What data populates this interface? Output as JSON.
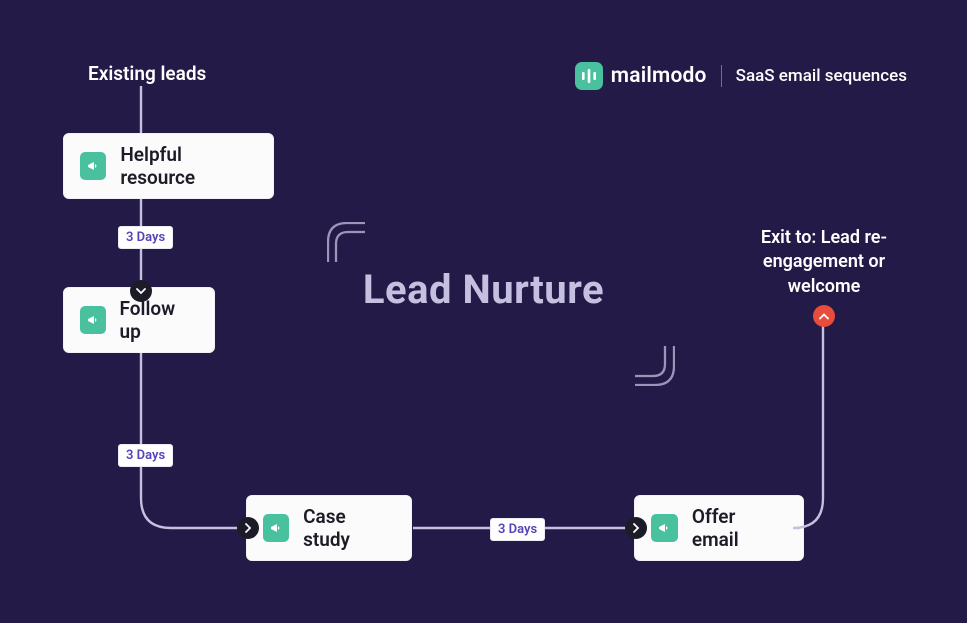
{
  "brand": {
    "name": "mailmodo",
    "tagline": "SaaS email sequences"
  },
  "title": "Lead Nurture",
  "entry_label": "Existing leads",
  "exit_label": "Exit to: Lead re-engagement or welcome",
  "nodes": {
    "n1": "Helpful resource",
    "n2": "Follow up",
    "n3": "Case study",
    "n4": "Offer email"
  },
  "delays": {
    "d1": "3 Days",
    "d2": "3 Days",
    "d3": "3 Days"
  }
}
